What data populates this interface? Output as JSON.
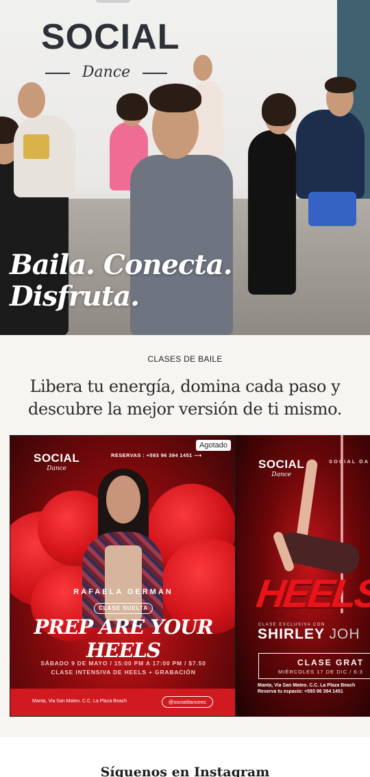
{
  "hero": {
    "wall_logo": {
      "word": "SOCIAL",
      "script": "Dance"
    },
    "headline_line1": "Baila. Conecta.",
    "headline_line2": "Disfruta."
  },
  "intro": {
    "eyebrow": "CLASES DE BAILE",
    "lead_line1": "Libera tu energía, domina cada paso y",
    "lead_line2": "descubre la mejor versión de ti mismo."
  },
  "carousel": {
    "cards": [
      {
        "badge": "Agotado",
        "logo_word": "SOCIAL",
        "logo_script": "Dance",
        "reservas": "RESERVAS : +593 96 394 1451",
        "instructor": "RAFAELA GERMAN",
        "pill": "CLASE SUELTA",
        "title": "PREP ARE YOUR HEELS",
        "date": "SÁBADO 9 DE MAYO / 15:00 PM A 17:00 PM / $7.50",
        "subtitle": "CLASE INTENSIVA DE HEELS + GRABACIÓN",
        "address": "Manta, Via San Mateo. C.C. La Plaza Beach",
        "instagram": "@socialdanceec"
      },
      {
        "logo_word": "SOCIAL",
        "logo_script": "Dance",
        "top_right": "SOCIAL DA",
        "title": "HEELST",
        "exclusive": "CLASE EXCLUSIVA CON",
        "instructor_first": "SHIRLEY",
        "instructor_last": "JOH",
        "box_title": "CLASE GRAT",
        "box_date": "MIÉRCOLES 17 DE DIC / 6:3",
        "address": "Manta, Via San Mateo. C.C. La Plaza Beach",
        "reserva": "Reserva tu espacio: +593 96 394 1451"
      }
    ]
  },
  "instagram": {
    "title": "Síguenos en Instagram"
  },
  "colors": {
    "accent_red": "#d11a20",
    "wall_blue": "#3f6170",
    "intro_bg": "#f7f5f2"
  }
}
